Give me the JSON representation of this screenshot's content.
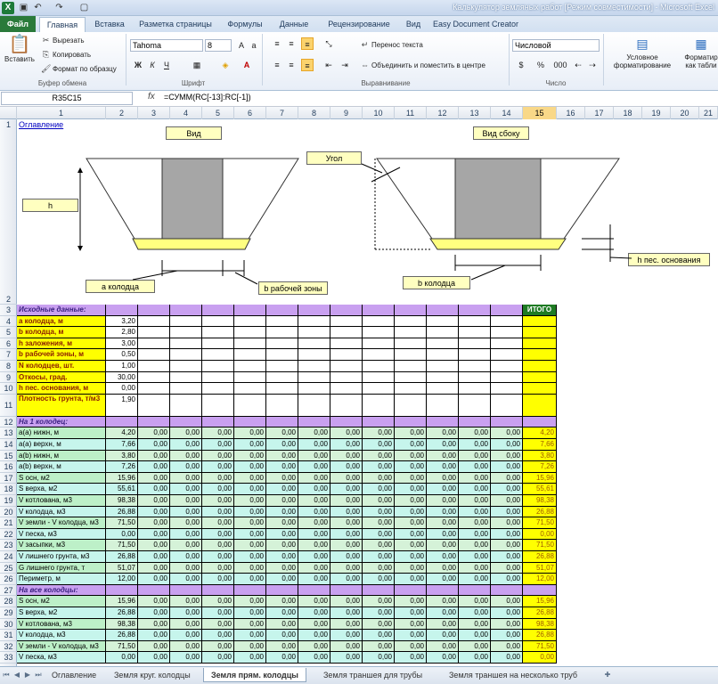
{
  "window": {
    "title": "Калькулятор земляных работ  [Режим совместимости]  -  Microsoft Excel"
  },
  "tabs": [
    "Файл",
    "Главная",
    "Вставка",
    "Разметка страницы",
    "Формулы",
    "Данные",
    "Рецензирование",
    "Вид",
    "Easy Document Creator"
  ],
  "clipboard": {
    "paste": "Вставить",
    "cut": "Вырезать",
    "copy": "Копировать",
    "painter": "Формат по образцу",
    "group": "Буфер обмена"
  },
  "font": {
    "name": "Tahoma",
    "size": "8",
    "group": "Шрифт",
    "bold": "Ж",
    "italic": "К",
    "underline": "Ч"
  },
  "alignment": {
    "wrap": "Перенос текста",
    "merge": "Объединить и поместить в центре",
    "group": "Выравнивание"
  },
  "number": {
    "format": "Числовой",
    "group": "Число",
    "currency": "%",
    "thousands": "000"
  },
  "styles": {
    "cond": "Условное форматирование",
    "table": "Форматир как табли"
  },
  "formula_bar": {
    "name_box": "R35C15",
    "fx": "fx",
    "formula": "=СУММ(RC[-13]:RC[-1])"
  },
  "columns": [
    "1",
    "2",
    "3",
    "4",
    "5",
    "6",
    "7",
    "8",
    "9",
    "10",
    "11",
    "12",
    "13",
    "14",
    "15",
    "16",
    "17",
    "18",
    "19",
    "20",
    "21"
  ],
  "selected_column": "15",
  "link_toc": "Оглавление",
  "diagram": {
    "view": "Вид",
    "side_view": "Вид сбоку",
    "angle": "Угол",
    "h": "h",
    "a_well": "а колодца",
    "b_work": "b рабочей  зоны",
    "b_well": "b колодца",
    "h_sand": "h пес. основания"
  },
  "section_input": "Исходные данные:",
  "section_one": "На 1 колодец:",
  "section_all": "На все колодцы:",
  "itogo": "ИТОГО",
  "input_rows": [
    {
      "n": "4",
      "label": "а колодца, м",
      "value": "3,20"
    },
    {
      "n": "5",
      "label": "b колодца, м",
      "value": "2,80"
    },
    {
      "n": "6",
      "label": "h заложения, м",
      "value": "3,00"
    },
    {
      "n": "7",
      "label": "b рабочей зоны, м",
      "value": "0,50"
    },
    {
      "n": "8",
      "label": "N колодцев, шт.",
      "value": "1,00"
    },
    {
      "n": "9",
      "label": "Откосы, град.",
      "value": "30,00"
    },
    {
      "n": "10",
      "label": "h пес. основания, м",
      "value": "0,00"
    },
    {
      "n": "11",
      "label": "Плотность грунта, т/м3",
      "value": "1,90"
    }
  ],
  "one_rows": [
    {
      "n": "13",
      "label": "а(a) нижн, м",
      "value": "4,20",
      "total": "4,20"
    },
    {
      "n": "14",
      "label": "а(a) верхн, м",
      "value": "7,66",
      "total": "7,66"
    },
    {
      "n": "15",
      "label": "а(b) нижн, м",
      "value": "3,80",
      "total": "3,80"
    },
    {
      "n": "16",
      "label": "а(b) верхн, м",
      "value": "7,26",
      "total": "7,26"
    },
    {
      "n": "17",
      "label": "S осн, м2",
      "value": "15,96",
      "total": "15,96"
    },
    {
      "n": "18",
      "label": "S верха, м2",
      "value": "55,61",
      "total": "55,61"
    },
    {
      "n": "19",
      "label": "V котлована, м3",
      "value": "98,38",
      "total": "98,38"
    },
    {
      "n": "20",
      "label": "V колодца, м3",
      "value": "26,88",
      "total": "26,88"
    },
    {
      "n": "21",
      "label": "V земли - V колодца, м3",
      "value": "71,50",
      "total": "71,50"
    },
    {
      "n": "22",
      "label": "V песка, м3",
      "value": "0,00",
      "total": "0,00"
    },
    {
      "n": "23",
      "label": "V засыпки, м3",
      "value": "71,50",
      "total": "71,50"
    },
    {
      "n": "24",
      "label": "V лишнего грунта, м3",
      "value": "26,88",
      "total": "26,88"
    },
    {
      "n": "25",
      "label": "G лишнего грунта, т",
      "value": "51,07",
      "total": "51,07"
    },
    {
      "n": "26",
      "label": "Периметр, м",
      "value": "12,00",
      "total": "12,00"
    }
  ],
  "all_rows": [
    {
      "n": "28",
      "label": "S осн, м2",
      "value": "15,96",
      "total": "15,96"
    },
    {
      "n": "29",
      "label": "S верха, м2",
      "value": "26,88",
      "total": "26,88"
    },
    {
      "n": "30",
      "label": "V котлована, м3",
      "value": "98,38",
      "total": "98,38"
    },
    {
      "n": "31",
      "label": "V колодца, м3",
      "value": "26,88",
      "total": "26,88"
    },
    {
      "n": "32",
      "label": "V земли - V колодца, м3",
      "value": "71,50",
      "total": "71,50"
    },
    {
      "n": "33",
      "label": "V песка, м3",
      "value": "0,00",
      "total": "0,00"
    }
  ],
  "zero": "0,00",
  "sheets": [
    "Оглавление",
    "Земля круг. колодцы",
    "Земля прям. колодцы",
    "Земля траншея для трубы",
    "Земля траншея на несколько труб"
  ],
  "active_sheet": "Земля прям. колодцы",
  "colors": {
    "band": "#c9a0f0",
    "itogo": "#ffff00",
    "green_hdr": "#1e7b23"
  }
}
